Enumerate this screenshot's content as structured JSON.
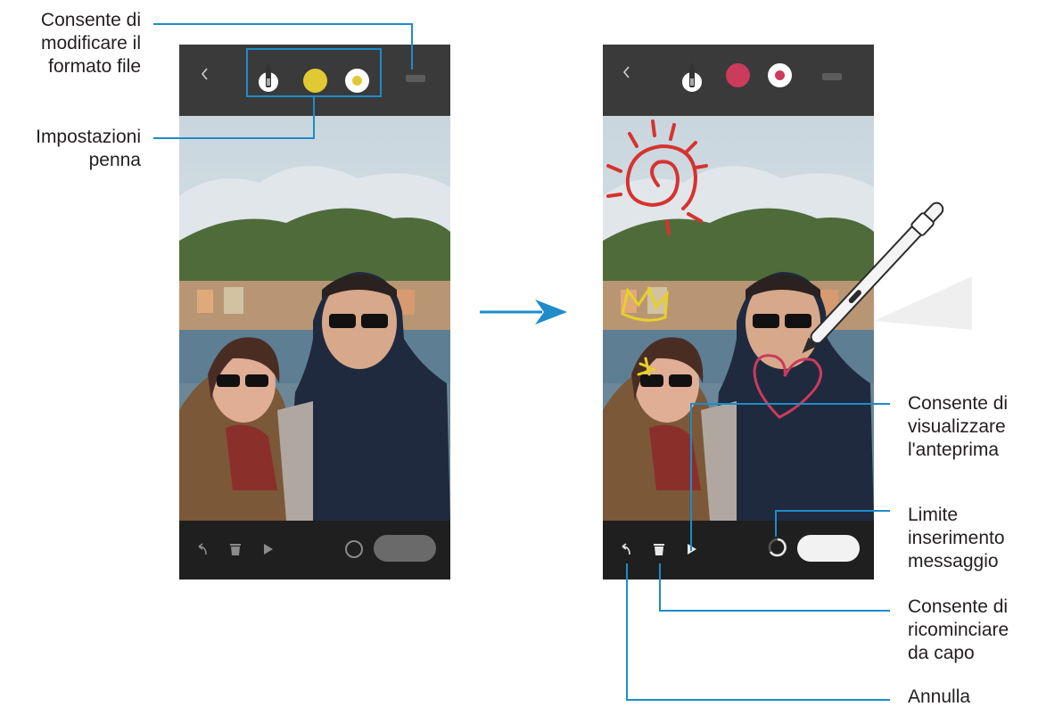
{
  "callouts": {
    "format_file": [
      "Consente di",
      "modificare il",
      "formato file"
    ],
    "pen_settings": [
      "Impostazioni",
      "penna"
    ],
    "preview": [
      "Consente di",
      "visualizzare",
      "l'anteprima"
    ],
    "message_limit": [
      "Limite",
      "inserimento",
      "messaggio"
    ],
    "restart": [
      "Consente di",
      "ricominciare",
      "da capo"
    ],
    "undo": [
      "Annulla"
    ]
  },
  "phone_before": {
    "top_icons": [
      "back-chevron-icon",
      "pen-icon",
      "color-swatch-icon",
      "pen-size-icon",
      "file-format-icon"
    ],
    "pen_color": "#e1c933",
    "bottom_icons": [
      "undo-icon",
      "trash-icon",
      "play-icon",
      "message-limit-ring-icon"
    ]
  },
  "phone_after": {
    "top_icons": [
      "back-chevron-icon",
      "pen-icon",
      "color-swatch-icon",
      "pen-size-icon",
      "file-format-icon"
    ],
    "pen_color": "#cc3b5c",
    "bottom_icons": [
      "undo-icon",
      "trash-icon",
      "play-icon",
      "message-limit-ring-icon"
    ]
  },
  "colors": {
    "callout_line": "#1e8cc9",
    "arrow": "#1e8cc9",
    "drawing_red": "#d6332f",
    "drawing_yellow": "#e6d12a"
  }
}
